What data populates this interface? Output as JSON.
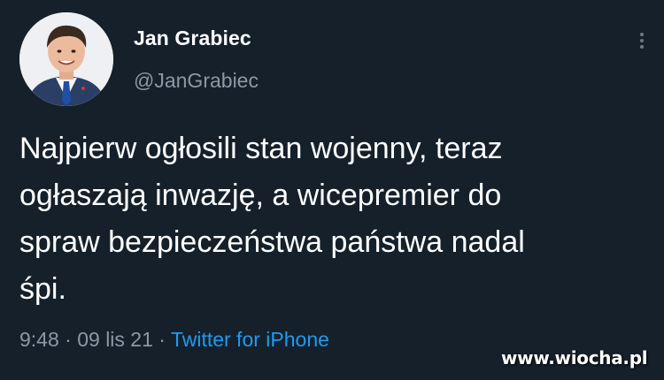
{
  "author": {
    "display_name": "Jan Grabiec",
    "handle": "@JanGrabiec",
    "avatar_icon": "profile-photo"
  },
  "more_icon": "vertical-dots-icon",
  "tweet": {
    "text": "Najpierw ogłosili stan wojenny, teraz\nogłaszają inwazję, a wicepremier do\nspraw bezpieczeństwa państwa nadal\nśpi.",
    "time": "9:48",
    "date": "09 lis 21",
    "separator": "·",
    "source": "Twitter for iPhone"
  },
  "watermark": "www.wiocha.pl",
  "colors": {
    "background": "#15202b",
    "text": "#ffffff",
    "secondary": "#8b98a5",
    "link": "#1d9bf0"
  }
}
